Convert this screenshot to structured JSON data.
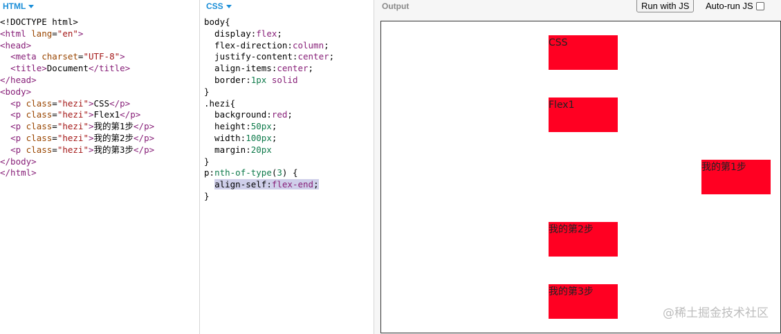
{
  "html_panel": {
    "label": "HTML",
    "lines": [
      [
        {
          "c": "plain",
          "t": "<!DOCTYPE html>"
        }
      ],
      [
        {
          "c": "tag",
          "t": "<html "
        },
        {
          "c": "attr",
          "t": "lang"
        },
        {
          "c": "plain",
          "t": "="
        },
        {
          "c": "str",
          "t": "\"en\""
        },
        {
          "c": "tag",
          "t": ">"
        }
      ],
      [
        {
          "c": "tag",
          "t": "<head>"
        }
      ],
      [
        {
          "c": "plain",
          "t": "  "
        },
        {
          "c": "tag",
          "t": "<meta "
        },
        {
          "c": "attr",
          "t": "charset"
        },
        {
          "c": "plain",
          "t": "="
        },
        {
          "c": "str",
          "t": "\"UTF-8\""
        },
        {
          "c": "tag",
          "t": ">"
        }
      ],
      [
        {
          "c": "plain",
          "t": "  "
        },
        {
          "c": "tag",
          "t": "<title>"
        },
        {
          "c": "plain",
          "t": "Document"
        },
        {
          "c": "tag",
          "t": "</title>"
        }
      ],
      [
        {
          "c": "tag",
          "t": "</head>"
        }
      ],
      [
        {
          "c": "tag",
          "t": "<body>"
        }
      ],
      [
        {
          "c": "plain",
          "t": "  "
        },
        {
          "c": "tag",
          "t": "<p "
        },
        {
          "c": "attr",
          "t": "class"
        },
        {
          "c": "plain",
          "t": "="
        },
        {
          "c": "str",
          "t": "\"hezi\""
        },
        {
          "c": "tag",
          "t": ">"
        },
        {
          "c": "plain",
          "t": "CSS"
        },
        {
          "c": "tag",
          "t": "</p>"
        }
      ],
      [
        {
          "c": "plain",
          "t": "  "
        },
        {
          "c": "tag",
          "t": "<p "
        },
        {
          "c": "attr",
          "t": "class"
        },
        {
          "c": "plain",
          "t": "="
        },
        {
          "c": "str",
          "t": "\"hezi\""
        },
        {
          "c": "tag",
          "t": ">"
        },
        {
          "c": "plain",
          "t": "Flex1"
        },
        {
          "c": "tag",
          "t": "</p>"
        }
      ],
      [
        {
          "c": "plain",
          "t": "  "
        },
        {
          "c": "tag",
          "t": "<p "
        },
        {
          "c": "attr",
          "t": "class"
        },
        {
          "c": "plain",
          "t": "="
        },
        {
          "c": "str",
          "t": "\"hezi\""
        },
        {
          "c": "tag",
          "t": ">"
        },
        {
          "c": "plain",
          "t": "我的第1步"
        },
        {
          "c": "tag",
          "t": "</p>"
        }
      ],
      [
        {
          "c": "plain",
          "t": "  "
        },
        {
          "c": "tag",
          "t": "<p "
        },
        {
          "c": "attr",
          "t": "class"
        },
        {
          "c": "plain",
          "t": "="
        },
        {
          "c": "str",
          "t": "\"hezi\""
        },
        {
          "c": "tag",
          "t": ">"
        },
        {
          "c": "plain",
          "t": "我的第2步"
        },
        {
          "c": "tag",
          "t": "</p>"
        }
      ],
      [
        {
          "c": "plain",
          "t": "  "
        },
        {
          "c": "tag",
          "t": "<p "
        },
        {
          "c": "attr",
          "t": "class"
        },
        {
          "c": "plain",
          "t": "="
        },
        {
          "c": "str",
          "t": "\"hezi\""
        },
        {
          "c": "tag",
          "t": ">"
        },
        {
          "c": "plain",
          "t": "我的第3步"
        },
        {
          "c": "tag",
          "t": "</p>"
        }
      ],
      [
        {
          "c": "tag",
          "t": "</body>"
        }
      ],
      [
        {
          "c": "tag",
          "t": "</html>"
        }
      ]
    ]
  },
  "css_panel": {
    "label": "CSS",
    "lines": [
      [
        {
          "c": "sel",
          "t": "body{"
        }
      ],
      [
        {
          "c": "prop",
          "t": "  display:"
        },
        {
          "c": "kw",
          "t": "flex"
        },
        {
          "c": "plain",
          "t": ";"
        }
      ],
      [
        {
          "c": "prop",
          "t": "  flex-direction:"
        },
        {
          "c": "kw",
          "t": "column"
        },
        {
          "c": "plain",
          "t": ";"
        }
      ],
      [
        {
          "c": "prop",
          "t": "  justify-content:"
        },
        {
          "c": "kw",
          "t": "center"
        },
        {
          "c": "plain",
          "t": ";"
        }
      ],
      [
        {
          "c": "prop",
          "t": "  align-items:"
        },
        {
          "c": "kw",
          "t": "center"
        },
        {
          "c": "plain",
          "t": ";"
        }
      ],
      [
        {
          "c": "prop",
          "t": "  border:"
        },
        {
          "c": "num",
          "t": "1px"
        },
        {
          "c": "plain",
          "t": " "
        },
        {
          "c": "kw",
          "t": "solid"
        }
      ],
      [
        {
          "c": "sel",
          "t": "}"
        }
      ],
      [
        {
          "c": "sel",
          "t": ".hezi{"
        }
      ],
      [
        {
          "c": "prop",
          "t": "  background:"
        },
        {
          "c": "kw",
          "t": "red"
        },
        {
          "c": "plain",
          "t": ";"
        }
      ],
      [
        {
          "c": "prop",
          "t": "  height:"
        },
        {
          "c": "num",
          "t": "50px"
        },
        {
          "c": "plain",
          "t": ";"
        }
      ],
      [
        {
          "c": "prop",
          "t": "  width:"
        },
        {
          "c": "num",
          "t": "100px"
        },
        {
          "c": "plain",
          "t": ";"
        }
      ],
      [
        {
          "c": "prop",
          "t": "  margin:"
        },
        {
          "c": "num",
          "t": "20px"
        }
      ],
      [
        {
          "c": "sel",
          "t": "}"
        }
      ],
      [
        {
          "c": "sel",
          "t": "p:"
        },
        {
          "c": "num",
          "t": "nth-of-type"
        },
        {
          "c": "plain",
          "t": "("
        },
        {
          "c": "num",
          "t": "3"
        },
        {
          "c": "plain",
          "t": ") {"
        }
      ],
      [
        {
          "c": "prop",
          "t": "  align-self:"
        },
        {
          "c": "kw",
          "t": "flex-end"
        },
        {
          "c": "plain",
          "t": ";"
        }
      ],
      [
        {
          "c": "sel",
          "t": "}"
        }
      ]
    ]
  },
  "output_panel": {
    "label": "Output",
    "run_button": "Run with JS",
    "autorun_label": "Auto-run JS",
    "autorun_checked": false,
    "boxes": [
      "CSS",
      "Flex1",
      "我的第1步",
      "我的第2步",
      "我的第3步"
    ],
    "box_color": "#ff0022",
    "watermark": "@稀土掘金技术社区"
  }
}
